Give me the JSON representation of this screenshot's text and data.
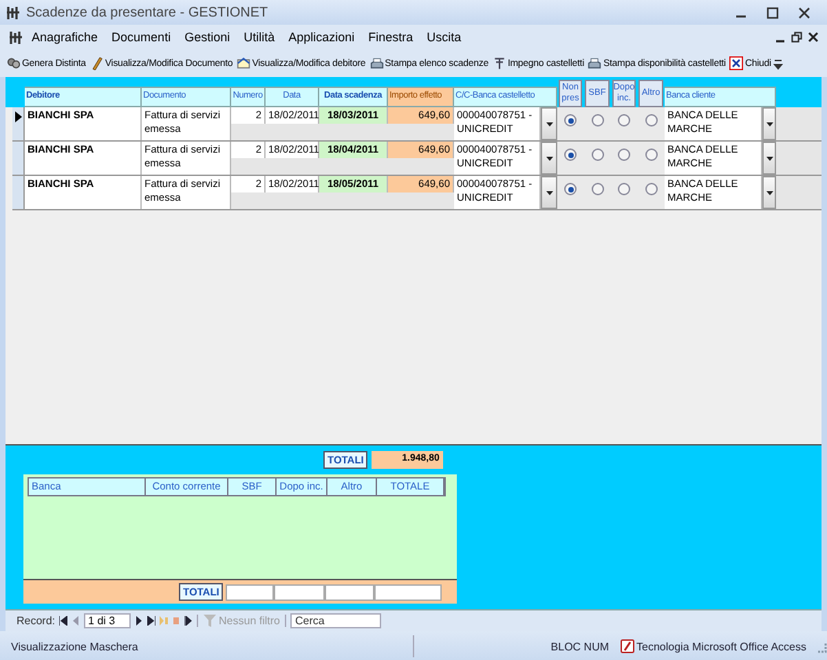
{
  "window": {
    "title": "Scadenze da presentare - GESTIONET"
  },
  "menu": [
    {
      "label": "Anagrafiche"
    },
    {
      "label": "Documenti"
    },
    {
      "label": "Gestioni"
    },
    {
      "label": "Utilità"
    },
    {
      "label": "Applicazioni"
    },
    {
      "label": "Finestra"
    },
    {
      "label": "Uscita"
    }
  ],
  "toolbar": [
    {
      "label": "Genera Distinta"
    },
    {
      "label": "Visualizza/Modifica Documento"
    },
    {
      "label": "Visualizza/Modifica debitore"
    },
    {
      "label": "Stampa elenco scadenze"
    },
    {
      "label": "Impegno castelletti"
    },
    {
      "label": "Stampa disponibilità castelletti"
    },
    {
      "label": "Chiudi"
    }
  ],
  "table": {
    "columns": [
      "Debitore",
      "Documento",
      "Numero",
      "Data",
      "Data scadenza",
      "Importo effetto",
      "C/C-Banca castelletto",
      "Non pres",
      "SBF",
      "Dopo inc.",
      "Altro",
      "Banca cliente"
    ],
    "rows": [
      {
        "current": true,
        "debitore": "BIANCHI SPA",
        "documento": "Fattura di servizi emessa",
        "numero": "2",
        "data": "18/02/2011",
        "data_scadenza": "18/03/2011",
        "importo": "649,60",
        "conto": "000040078751 - UNICREDIT",
        "options": [
          {
            "selected": true
          },
          {
            "selected": false
          },
          {
            "selected": false
          },
          {
            "selected": false
          }
        ],
        "banca_cliente": "BANCA DELLE MARCHE"
      },
      {
        "current": false,
        "debitore": "BIANCHI SPA",
        "documento": "Fattura di servizi emessa",
        "numero": "2",
        "data": "18/02/2011",
        "data_scadenza": "18/04/2011",
        "importo": "649,60",
        "conto": "000040078751 - UNICREDIT",
        "options": [
          {
            "selected": true
          },
          {
            "selected": false
          },
          {
            "selected": false
          },
          {
            "selected": false
          }
        ],
        "banca_cliente": "BANCA DELLE MARCHE"
      },
      {
        "current": false,
        "debitore": "BIANCHI SPA",
        "documento": "Fattura di servizi emessa",
        "numero": "2",
        "data": "18/02/2011",
        "data_scadenza": "18/05/2011",
        "importo": "649,60",
        "conto": "000040078751 - UNICREDIT",
        "options": [
          {
            "selected": true
          },
          {
            "selected": false
          },
          {
            "selected": false
          },
          {
            "selected": false
          }
        ],
        "banca_cliente": "BANCA DELLE MARCHE"
      }
    ]
  },
  "totals": {
    "label": "TOTALI",
    "value": "1.948,80"
  },
  "summary": {
    "columns": [
      "Banca",
      "Conto corrente",
      "SBF",
      "Dopo inc.",
      "Altro",
      "TOTALE"
    ],
    "totals_label": "TOTALI"
  },
  "navigation": {
    "label": "Record:",
    "position": "1 di 3",
    "filter": {
      "label": "Nessun filtro",
      "disabled": true
    },
    "search": {
      "placeholder": "Cerca"
    }
  },
  "status_bar": {
    "mode": "Visualizzazione Maschera",
    "indicator": "BLOC NUM",
    "product": "Tecnologia Microsoft Office Access"
  }
}
